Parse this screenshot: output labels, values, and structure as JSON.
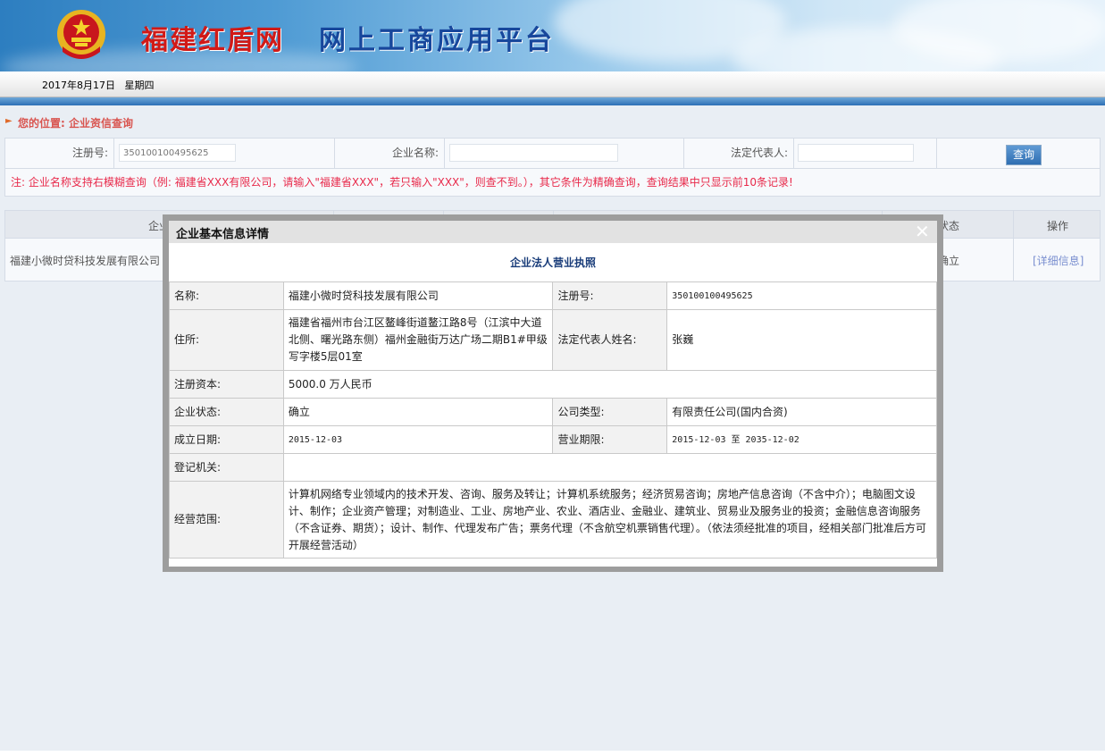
{
  "header": {
    "site_name": "福建红盾网",
    "platform_name": "网上工商应用平台",
    "date": "2017年8月17日",
    "weekday": "星期四"
  },
  "breadcrumb": {
    "text": "您的位置: 企业资信查询"
  },
  "search": {
    "reg_no_label": "注册号:",
    "reg_no_value": "350100100495625",
    "company_name_label": "企业名称:",
    "company_name_value": "",
    "legal_rep_label": "法定代表人:",
    "legal_rep_value": "",
    "query_button": "查询"
  },
  "note": "注: 企业名称支持右模糊查询（例: 福建省XXX有限公司，请输入\"福建省XXX\"，若只输入\"XXX\"，则查不到。），其它条件为精确查询，查询结果中只显示前10条记录!",
  "results": {
    "headers": {
      "company": "企业",
      "status": "状态",
      "action": "操作"
    },
    "row": {
      "company": "福建小微时贷科技发展有限公司",
      "status": "确立",
      "action": "[详细信息]"
    }
  },
  "dialog": {
    "title": "企业基本信息详情",
    "close_icon": "close-icon",
    "license_title": "企业法人营业执照",
    "fields": {
      "name_label": "名称:",
      "name_value": "福建小微时贷科技发展有限公司",
      "reg_no_label": "注册号:",
      "reg_no_value": "350100100495625",
      "address_label": "住所:",
      "address_value": "福建省福州市台江区鳌峰街道鳌江路8号（江滨中大道北侧、曙光路东侧）福州金融街万达广场二期B1#甲级写字楼5层01室",
      "legal_rep_label": "法定代表人姓名:",
      "legal_rep_value": "张巍",
      "capital_label": "注册资本:",
      "capital_value": "5000.0  万人民币",
      "status_label": "企业状态:",
      "status_value": "确立",
      "company_type_label": "公司类型:",
      "company_type_value": "有限责任公司(国内合资)",
      "established_label": "成立日期:",
      "established_value": "2015-12-03",
      "term_label": "营业期限:",
      "term_value": "2015-12-03 至 2035-12-02",
      "authority_label": "登记机关:",
      "authority_value": "",
      "scope_label": "经营范围:",
      "scope_value": "计算机网络专业领域内的技术开发、咨询、服务及转让；计算机系统服务；经济贸易咨询；房地产信息咨询（不含中介）；电脑图文设计、制作；企业资产管理；对制造业、工业、房地产业、农业、酒店业、金融业、建筑业、贸易业及服务业的投资；金融信息咨询服务（不含证券、期货）；设计、制作、代理发布广告；票务代理（不含航空机票销售代理）。（依法须经批准的项目，经相关部门批准后方可开展经营活动）"
    }
  },
  "colors": {
    "site_name": "#d11a17",
    "platform_name": "#17479c",
    "note": "#e8294a",
    "breadcrumb": "#d9544f"
  }
}
